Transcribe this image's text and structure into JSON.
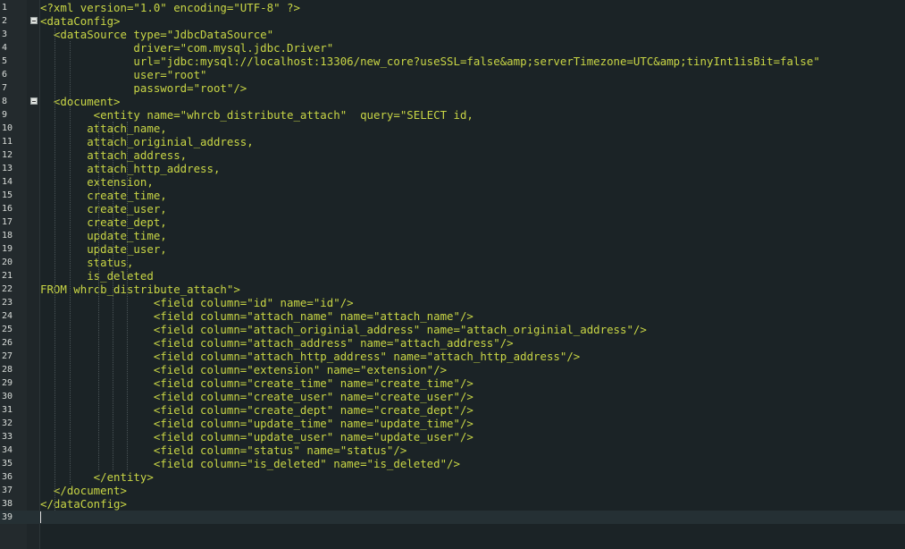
{
  "editor": {
    "lines": [
      {
        "n": "1",
        "text": "<?xml version=\"1.0\" encoding=\"UTF-8\" ?>"
      },
      {
        "n": "2",
        "text": "<dataConfig>",
        "fold": true
      },
      {
        "n": "3",
        "text": "  <dataSource type=\"JdbcDataSource\""
      },
      {
        "n": "4",
        "text": "              driver=\"com.mysql.jdbc.Driver\""
      },
      {
        "n": "5",
        "text": "              url=\"jdbc:mysql://localhost:13306/new_core?useSSL=false&amp;serverTimezone=UTC&amp;tinyInt1isBit=false\""
      },
      {
        "n": "6",
        "text": "              user=\"root\""
      },
      {
        "n": "7",
        "text": "              password=\"root\"/>"
      },
      {
        "n": "8",
        "text": "  <document>",
        "fold": true
      },
      {
        "n": "9",
        "text": "        <entity name=\"whrcb_distribute_attach\"  query=\"SELECT id,"
      },
      {
        "n": "10",
        "text": "       attach_name,"
      },
      {
        "n": "11",
        "text": "       attach_originial_address,"
      },
      {
        "n": "12",
        "text": "       attach_address,"
      },
      {
        "n": "13",
        "text": "       attach_http_address,"
      },
      {
        "n": "14",
        "text": "       extension,"
      },
      {
        "n": "15",
        "text": "       create_time,"
      },
      {
        "n": "16",
        "text": "       create_user,"
      },
      {
        "n": "17",
        "text": "       create_dept,"
      },
      {
        "n": "18",
        "text": "       update_time,"
      },
      {
        "n": "19",
        "text": "       update_user,"
      },
      {
        "n": "20",
        "text": "       status,"
      },
      {
        "n": "21",
        "text": "       is_deleted"
      },
      {
        "n": "22",
        "text": "FROM whrcb_distribute_attach\">"
      },
      {
        "n": "23",
        "text": "                 <field column=\"id\" name=\"id\"/>"
      },
      {
        "n": "24",
        "text": "                 <field column=\"attach_name\" name=\"attach_name\"/>"
      },
      {
        "n": "25",
        "text": "                 <field column=\"attach_originial_address\" name=\"attach_originial_address\"/>"
      },
      {
        "n": "26",
        "text": "                 <field column=\"attach_address\" name=\"attach_address\"/>"
      },
      {
        "n": "27",
        "text": "                 <field column=\"attach_http_address\" name=\"attach_http_address\"/>"
      },
      {
        "n": "28",
        "text": "                 <field column=\"extension\" name=\"extension\"/>"
      },
      {
        "n": "29",
        "text": "                 <field column=\"create_time\" name=\"create_time\"/>"
      },
      {
        "n": "30",
        "text": "                 <field column=\"create_user\" name=\"create_user\"/>"
      },
      {
        "n": "31",
        "text": "                 <field column=\"create_dept\" name=\"create_dept\"/>"
      },
      {
        "n": "32",
        "text": "                 <field column=\"update_time\" name=\"update_time\"/>"
      },
      {
        "n": "33",
        "text": "                 <field column=\"update_user\" name=\"update_user\"/>"
      },
      {
        "n": "34",
        "text": "                 <field column=\"status\" name=\"status\"/>"
      },
      {
        "n": "35",
        "text": "                 <field column=\"is_deleted\" name=\"is_deleted\"/>"
      },
      {
        "n": "36",
        "text": "        </entity>"
      },
      {
        "n": "37",
        "text": "  </document>"
      },
      {
        "n": "38",
        "text": "</dataConfig>"
      },
      {
        "n": "39",
        "text": "",
        "current": true
      }
    ]
  },
  "colors": {
    "background": "#1b2326",
    "gutter": "#232a2d",
    "current_line": "#253034",
    "syntax_accent": "#c9d645",
    "line_number": "#d8dcd9"
  }
}
